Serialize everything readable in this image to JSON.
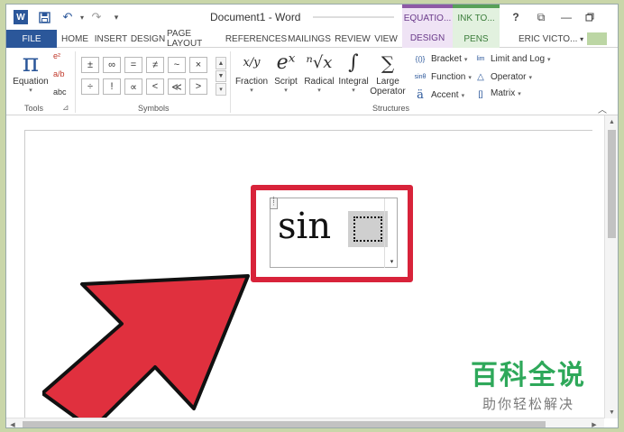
{
  "window": {
    "title": "Document1 - Word",
    "context_tabs": {
      "equation": "EQUATIO...",
      "ink": "INK TO..."
    },
    "controls": {
      "help": "?",
      "restore_ribbon": "⧉",
      "minimize": "—"
    }
  },
  "quick_access": {
    "word": "W",
    "save": "💾",
    "undo": "↶",
    "redo": "↷",
    "customize": "▾"
  },
  "tabs": [
    {
      "label": "FILE"
    },
    {
      "label": "HOME"
    },
    {
      "label": "INSERT"
    },
    {
      "label": "DESIGN"
    },
    {
      "label": "PAGE LAYOUT"
    },
    {
      "label": "REFERENCES"
    },
    {
      "label": "MAILINGS"
    },
    {
      "label": "REVIEW"
    },
    {
      "label": "VIEW"
    },
    {
      "label": "DESIGN"
    },
    {
      "label": "PENS"
    }
  ],
  "user": {
    "name": "ERIC VICTO...",
    "dropdown": "▾"
  },
  "ribbon": {
    "groups": {
      "tools": "Tools",
      "symbols": "Symbols",
      "structures": "Structures"
    },
    "tools": {
      "equation_glyph": "π",
      "equation_label": "Equation",
      "prof_glyph": "e²",
      "lin_glyph": "a/b",
      "abc_label": "abc",
      "launcher": "⊿"
    },
    "symbols": [
      "±",
      "∞",
      "=",
      "≠",
      "~",
      "×",
      "÷",
      "!",
      "∝",
      "<",
      "≪",
      ">"
    ],
    "symbols_scroll": {
      "up": "▲",
      "down": "▼",
      "more": "▾"
    },
    "structures_big": [
      {
        "glyph": "x/y",
        "label": "Fraction"
      },
      {
        "glyph": "eˣ",
        "label": "Script"
      },
      {
        "glyph": "ⁿ√x",
        "label": "Radical"
      },
      {
        "glyph": "∫",
        "label": "Integral"
      },
      {
        "glyph": "∑",
        "label": "Large Operator"
      }
    ],
    "structures_small": [
      {
        "icon": "{()}",
        "label": "Bracket"
      },
      {
        "icon": "sinθ",
        "label": "Function"
      },
      {
        "icon": "ä",
        "label": "Accent"
      },
      {
        "icon": "lim",
        "label": "Limit and Log"
      },
      {
        "icon": "△",
        "label": "Operator"
      },
      {
        "icon": "[]",
        "label": "Matrix"
      }
    ],
    "collapse": "︿"
  },
  "equation": {
    "text": "sin",
    "dropdown": "▾",
    "handle": "⋮"
  },
  "scrollbars": {
    "up": "▲",
    "down": "▼",
    "left": "◀",
    "right": "▶"
  },
  "watermark": {
    "title": "百科全说",
    "subtitle": "助你轻松解决"
  },
  "colors": {
    "word_blue": "#2b579a",
    "highlight_red": "#d8233a",
    "arrow_red": "#e0303e",
    "watermark_green": "#2ea85a"
  }
}
